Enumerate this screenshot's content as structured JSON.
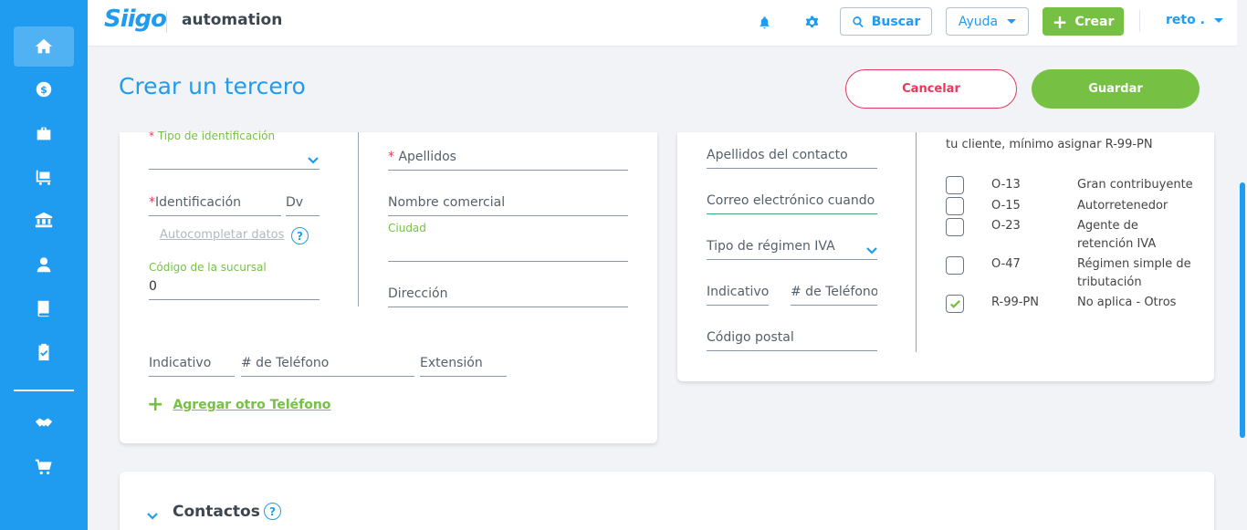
{
  "app": {
    "logo": "Siigo",
    "company": "automation"
  },
  "topbar": {
    "search_label": "Buscar",
    "help_label": "Ayuda",
    "create_label": "Crear",
    "user_label": "reto ."
  },
  "sidebar": {
    "items": [
      {
        "name": "home"
      },
      {
        "name": "money"
      },
      {
        "name": "sales"
      },
      {
        "name": "inventory"
      },
      {
        "name": "bank"
      },
      {
        "name": "person"
      },
      {
        "name": "book"
      },
      {
        "name": "clipboard"
      },
      {
        "name": "handshake"
      },
      {
        "name": "cart"
      }
    ]
  },
  "page": {
    "title": "Crear un tercero",
    "cancel_label": "Cancelar",
    "save_label": "Guardar"
  },
  "left_form": {
    "tipo_identificacion": "Tipo de identificación",
    "identificacion": "Identificación",
    "dv": "Dv",
    "autocompletar": "Autocompletar datos",
    "codigo_sucursal_label": "Código de la sucursal",
    "codigo_sucursal_value": "0",
    "apellidos": "Apellidos",
    "nombre_comercial": "Nombre comercial",
    "ciudad": "Ciudad",
    "direccion": "Dirección",
    "indicativo": "Indicativo",
    "telefono": "# de Teléfono",
    "extension": "Extensión",
    "agregar_telefono": "Agregar otro Teléfono",
    "required_mark": "*"
  },
  "contact_form": {
    "apellidos_contacto": "Apellidos del contacto",
    "correo": "Correo electrónico cuando aplique",
    "tipo_regimen": "Tipo de régimen IVA",
    "indicativo": "Indicativo",
    "telefono": "# de Teléfono",
    "codigo_postal": "Código postal"
  },
  "responsabilidades": {
    "header_text": "tu cliente, mínimo asignar R-99-PN",
    "items": [
      {
        "code": "O-13",
        "desc": "Gran contribuyente",
        "checked": false
      },
      {
        "code": "O-15",
        "desc": "Autorretenedor",
        "checked": false
      },
      {
        "code": "O-23",
        "desc": "Agente de retención IVA",
        "checked": false
      },
      {
        "code": "O-47",
        "desc": "Régimen simple de tributación",
        "checked": false
      },
      {
        "code": "R-99-PN",
        "desc": "No aplica - Otros",
        "checked": true
      }
    ]
  },
  "contacts_section": {
    "title": "Contactos",
    "help": "?"
  },
  "colors": {
    "primary": "#1f9bf0",
    "success": "#76c143",
    "danger": "#e8385a"
  }
}
